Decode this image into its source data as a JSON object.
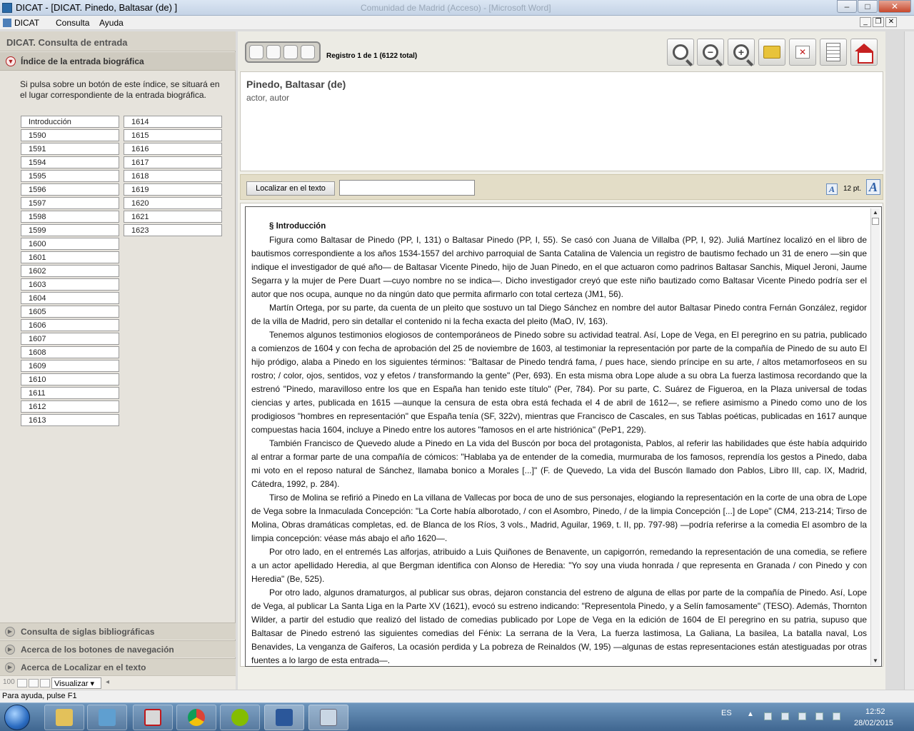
{
  "window": {
    "title": "DICAT - [DICAT. Pinedo, Baltasar (de) ]",
    "center_title": "Comunidad de Madrid (Acceso) - [Microsoft Word]"
  },
  "menu": {
    "items": [
      "DICAT",
      "Consulta",
      "Ayuda"
    ]
  },
  "left_panel": {
    "header": "DICAT. Consulta de entrada",
    "section_title": "Índice de la entrada biográfica",
    "help_text": "Si pulsa sobre un botón de este índice, se situará en el lugar correspondiente de la entrada biográfica.",
    "index_col1": [
      "Introducción",
      "1590",
      "1591",
      "1594",
      "1595",
      "1596",
      "1597",
      "1598",
      "1599",
      "1600",
      "1601",
      "1602",
      "1603",
      "1604",
      "1605",
      "1606",
      "1607",
      "1608",
      "1609",
      "1610",
      "1611",
      "1612",
      "1613"
    ],
    "index_col2": [
      "1614",
      "1615",
      "1616",
      "1617",
      "1618",
      "1619",
      "1620",
      "1621",
      "1623"
    ],
    "collapsed_sections": [
      "Consulta de siglas bibliográficas",
      "Acerca de los botones de navegación",
      "Acerca de Localizar en el texto"
    ],
    "mini_toolbar": {
      "zoom": "100",
      "view_select": "Visualizar"
    }
  },
  "toolbar": {
    "record_text": "Registro 1 de 1  (6122 total)",
    "icons": [
      "search-icon",
      "zoom-out-icon",
      "zoom-in-icon",
      "folder-icon",
      "close-document-icon",
      "document-list-icon",
      "home-icon"
    ]
  },
  "entry": {
    "name": "Pinedo, Baltasar (de)",
    "role": "actor, autor"
  },
  "search": {
    "button_label": "Localizar en el texto",
    "input_value": "",
    "font_size": "12 pt."
  },
  "content": {
    "section_heading": "§  Introducción",
    "paragraphs": [
      "Figura como Baltasar de Pinedo (PP, I, 131) o Baltasar Pinedo (PP, I, 55). Se casó con Juana de Villalba (PP, I, 92). Juliá Martínez localizó en el libro de bautismos correspondiente a los años 1534-1557 del archivo parroquial de Santa Catalina de Valencia un registro de bautismo fechado un 31 de enero —sin que indique el investigador de qué año— de Baltasar Vicente Pinedo, hijo de Juan Pinedo, en el que actuaron como padrinos Baltasar Sanchis, Miquel Jeroni, Jaume Segarra y la mujer de Pere Duart —cuyo nombre no se indica—. Dicho investigador creyó que este niño bautizado como Baltasar Vicente Pinedo podría ser el autor que nos ocupa, aunque no da ningún dato que permita afirmarlo con total certeza (JM1, 56).",
      "Martín Ortega, por su parte, da cuenta de un pleito que sostuvo un tal Diego Sánchez en nombre del autor Baltasar Pinedo contra Fernán González, regidor de la villa de Madrid, pero sin detallar el contenido ni la fecha exacta del pleito (MaO, IV, 163).",
      "Tenemos algunos testimonios elogiosos de contemporáneos de Pinedo sobre su actividad teatral. Así, Lope de Vega, en El peregrino en su patria, publicado a comienzos de 1604 y con fecha de aprobación del 25 de noviembre de 1603, al testimoniar la representación por parte de la compañía de Pinedo de su auto El hijo pródigo, alaba a Pinedo en los siguientes términos: \"Baltasar de Pinedo tendrá fama, / pues hace, siendo príncipe en su arte, / altos metamorfoseos en su rostro; / color, ojos, sentidos, voz y efetos / transformando la gente\" (Per, 693). En esta misma obra Lope alude a su obra La fuerza lastimosa recordando que la estrenó \"Pinedo, maravilloso entre los que en España han tenido este título\" (Per, 784). Por su parte, C. Suárez de Figueroa, en la Plaza universal de todas ciencias y artes, publicada en 1615 —aunque la censura de esta obra está fechada el 4 de abril de 1612—, se refiere asimismo a Pinedo como uno de los prodigiosos \"hombres en representación\" que España tenía (SF, 322v), mientras que Francisco de Cascales, en sus Tablas poéticas, publicadas en 1617 aunque compuestas hacia 1604, incluye a Pinedo entre los autores \"famosos en el arte histriónica\" (PeP1, 229).",
      "También Francisco de Quevedo alude a Pinedo en La vida del Buscón por boca del protagonista, Pablos, al referir las habilidades que éste había adquirido al entrar a formar parte de una compañía de cómicos: \"Hablaba ya de entender de la comedia, murmuraba de los famosos, reprendía los gestos a Pinedo, daba mi voto en el reposo natural de Sánchez, llamaba bonico a Morales [...]\" (F. de Quevedo, La vida del Buscón llamado don Pablos, Libro III, cap. IX, Madrid, Cátedra, 1992, p. 284).",
      "Tirso de Molina se refirió a Pinedo en La villana de Vallecas por boca de uno de sus personajes, elogiando la representación en la corte de una obra de Lope de Vega sobre la Inmaculada Concepción: \"La Corte había alborotado, / con el Asombro, Pinedo, / de la limpia Concepción [...] de Lope\" (CM4, 213-214; Tirso de Molina, Obras dramáticas completas, ed. de Blanca de los Ríos, 3 vols., Madrid, Aguilar, 1969, t. II, pp. 797-98) —podría referirse a la comedia El asombro de la limpia concepción: véase más abajo el año 1620—.",
      "Por otro lado, en el entremés Las alforjas, atribuido a Luis Quiñones de Benavente, un capigorrón, remedando la representación de una comedia, se refiere a un actor apellidado Heredia, al que Bergman identifica con Alonso de Heredia: \"Yo soy una viuda honrada / que representa en Granada / con Pinedo y con Heredia\" (Be, 525).",
      "Por otro lado, algunos dramaturgos, al publicar sus obras, dejaron constancia del estreno de alguna de ellas por parte de la compañía de Pinedo. Así, Lope de Vega, al publicar La Santa Liga en la Parte XV (1621), evocó su estreno indicando: \"Representola Pinedo, y a Selín famosamente\" (TESO). Además, Thornton Wilder, a partir del estudio que realizó del listado de comedias publicado por Lope de Vega en la edición de 1604 de El peregrino en su patria, supuso que Baltasar de Pinedo estrenó las siguientes comedias del Fénix: La serrana de la Vera, La fuerza lastimosa, La Galiana, La basilea, La batalla naval, Los Benavides, La venganza de Gaiferos, La ocasión perdida y La pobreza de Reinaldos (W, 195) —algunas de estas representaciones están atestiguadas por otras fuentes a lo largo de esta entrada—."
    ]
  },
  "status": {
    "text": "Para ayuda, pulse F1"
  },
  "taskbar": {
    "apps": [
      "explorer-icon",
      "photo-viewer-icon",
      "pdf-reader-icon",
      "chrome-icon",
      "spotify-icon",
      "word-icon",
      "remote-app-icon"
    ],
    "language": "ES",
    "time": "12:52",
    "date": "28/02/2015"
  }
}
